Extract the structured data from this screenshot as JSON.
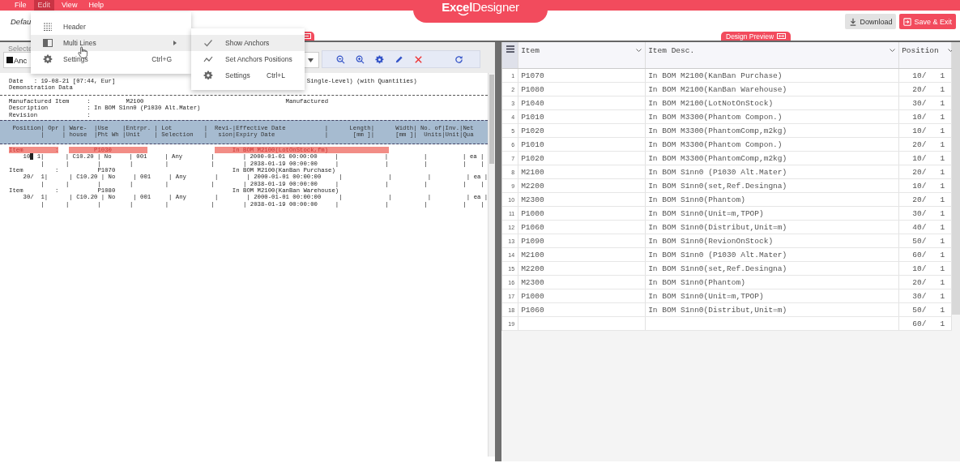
{
  "menu_bar": {
    "items": [
      {
        "label": "File",
        "selected": false
      },
      {
        "label": "Edit",
        "selected": true
      },
      {
        "label": "View",
        "selected": false
      },
      {
        "label": "Help",
        "selected": false
      }
    ]
  },
  "logo": {
    "text": "**Excel**Designer"
  },
  "document_title": "Defau",
  "buttons": [
    {
      "label": "Download",
      "kind": "secondary"
    },
    {
      "label": "Save & Exit",
      "kind": "primary"
    }
  ],
  "preview_tab": {
    "label": "Design Preview"
  },
  "selector": {
    "label": "Selecte",
    "value": "Anc"
  },
  "report": {
    "lines": [
      {
        "kind": "text",
        "segments": [
          {
            "kind": "plain",
            "text": "Date   : 19-08-21 [07:44, Eur]                                                      Single-Level) (with Quantities)"
          }
        ]
      },
      {
        "kind": "text",
        "segments": [
          {
            "kind": "plain",
            "text": "Demonstration Data"
          }
        ]
      },
      {
        "kind": "rule"
      },
      {
        "kind": "text",
        "segments": [
          {
            "kind": "plain",
            "text": "Manufactured Item     :          M2100                                        Manufactured"
          }
        ]
      },
      {
        "kind": "text",
        "segments": [
          {
            "kind": "plain",
            "text": "Description           : In BOM S1nn0 (P1030 Alt.Mater)"
          }
        ]
      },
      {
        "kind": "text",
        "segments": [
          {
            "kind": "plain",
            "text": "Revision              :"
          }
        ]
      },
      {
        "kind": "band",
        "lines": [
          " Position| Opr | Ware-  |Use    |Entrpr. | Lot         |  Revi-|Effective Date           |      Length|      Width| No. of|Inv.|Net",
          "         |     | house  |Pht Wh |Unit    | Selection   |   sion|Expiry Date              |       [mm ]|      [mm ]|  Units|Unit|Qua"
        ]
      },
      {
        "kind": "text",
        "segments": [
          {
            "kind": "anchor",
            "text": "Item         :"
          },
          {
            "kind": "anchor",
            "text": "       P1030          "
          },
          {
            "kind": "anchor",
            "text": "     In BOM M2100(LotOnStock,fm)                 "
          }
        ]
      },
      {
        "kind": "text",
        "segments": [
          {
            "kind": "plain",
            "text": "    10"
          },
          {
            "kind": "cursor"
          },
          {
            "kind": "plain",
            "text": " 1|      | C10.20 | No     | 001     | Any        |        | 2000-01-01 00:00:00     |             |          |          | ea |"
          }
        ]
      },
      {
        "kind": "text",
        "segments": [
          {
            "kind": "plain",
            "text": "         |      |        |        |         |            |        | 2038-01-19 00:00:00     |             |          |          |    |"
          }
        ]
      },
      {
        "kind": "text",
        "segments": [
          {
            "kind": "plain",
            "text": "Item         :           P1070                                 In BOM M2100(KanBan Purchase)"
          }
        ]
      },
      {
        "kind": "text",
        "segments": [
          {
            "kind": "plain",
            "text": "    20/  1|      | C10.20 | No     | 001     | Any        |        | 2000-01-01 00:00:00     |             |          |          | ea |"
          }
        ]
      },
      {
        "kind": "text",
        "segments": [
          {
            "kind": "plain",
            "text": "         |      |        |        |         |            |        | 2038-01-19 00:00:00     |             |          |          |    |"
          }
        ]
      },
      {
        "kind": "text",
        "segments": [
          {
            "kind": "plain",
            "text": "Item         :           P1080                                 In BOM M2100(KanBan Warehouse)"
          }
        ]
      },
      {
        "kind": "text",
        "segments": [
          {
            "kind": "plain",
            "text": "    30/  1|      | C10.20 | No     | 001     | Any        |        | 2000-01-01 00:00:00     |             |          |          | ea |"
          }
        ]
      },
      {
        "kind": "text",
        "segments": [
          {
            "kind": "plain",
            "text": "         |      |        |        |         |            |        | 2038-01-19 00:00:00     |             |          |          |    |"
          }
        ]
      }
    ]
  },
  "grid": {
    "columns": [
      "Item",
      "Item Desc.",
      "Position"
    ],
    "rows": [
      {
        "num": "1",
        "item": "P1070",
        "desc": "In BOM M2100(KanBan Purchase)",
        "position": "10/   1"
      },
      {
        "num": "2",
        "item": "P1080",
        "desc": "In BOM M2100(KanBan Warehouse)",
        "position": "20/   1"
      },
      {
        "num": "3",
        "item": "P1040",
        "desc": "In BOM M2100(LotNotOnStock)",
        "position": "30/   1"
      },
      {
        "num": "4",
        "item": "P1010",
        "desc": "In BOM M3300(Phantom Compon.)",
        "position": "10/   1"
      },
      {
        "num": "5",
        "item": "P1020",
        "desc": "In BOM M3300(PhantomComp,m2kg)",
        "position": "10/   1"
      },
      {
        "num": "6",
        "item": "P1010",
        "desc": "In BOM M3300(Phantom Compon.)",
        "position": "20/   1"
      },
      {
        "num": "7",
        "item": "P1020",
        "desc": "In BOM M3300(PhantomComp,m2kg)",
        "position": "10/   1"
      },
      {
        "num": "8",
        "item": "M2100",
        "desc": "In BOM S1nn0 (P1030 Alt.Mater)",
        "position": "20/   1"
      },
      {
        "num": "9",
        "item": "M2200",
        "desc": "In BOM S1nn0(set,Ref.Desingna)",
        "position": "10/   1"
      },
      {
        "num": "10",
        "item": "M2300",
        "desc": "In BOM S1nn0(Phantom)",
        "position": "20/   1"
      },
      {
        "num": "11",
        "item": "P1000",
        "desc": "In BOM S1nn0(Unit=m,TPOP)",
        "position": "30/   1"
      },
      {
        "num": "12",
        "item": "P1060",
        "desc": "In BOM S1nn0(Distribut,Unit=m)",
        "position": "40/   1"
      },
      {
        "num": "13",
        "item": "P1090",
        "desc": "In BOM S1nn0(RevionOnStock)",
        "position": "50/   1"
      },
      {
        "num": "14",
        "item": "M2100",
        "desc": "In BOM S1nn0 (P1030 Alt.Mater)",
        "position": "60/   1"
      },
      {
        "num": "15",
        "item": "M2200",
        "desc": "In BOM S1nn0(set,Ref.Desingna)",
        "position": "10/   1"
      },
      {
        "num": "16",
        "item": "M2300",
        "desc": "In BOM S1nn0(Phantom)",
        "position": "20/   1"
      },
      {
        "num": "17",
        "item": "P1000",
        "desc": "In BOM S1nn0(Unit=m,TPOP)",
        "position": "30/   1"
      },
      {
        "num": "18",
        "item": "P1060",
        "desc": "In BOM S1nn0(Distribut,Unit=m)",
        "position": "50/   1"
      },
      {
        "num": "19",
        "position": "60/   1"
      }
    ]
  },
  "edit_menu": {
    "items": [
      {
        "label": "Header",
        "kind": "header",
        "selected": false
      },
      {
        "label": "Multi Lines",
        "kind": "multi-lines",
        "selected": true,
        "submenu": true
      },
      {
        "label": "Settings",
        "kind": "settings",
        "selected": false,
        "shortcut": "Ctrl+G"
      }
    ]
  },
  "submenu": {
    "items": [
      {
        "label": "Show Anchors",
        "kind": "toggle",
        "checked": true,
        "selected": true
      },
      {
        "label": "Set Anchors Positions",
        "kind": "positions",
        "selected": false
      },
      {
        "label": "Settings",
        "kind": "settings",
        "selected": false,
        "shortcut": "Ctrl+L"
      }
    ]
  }
}
